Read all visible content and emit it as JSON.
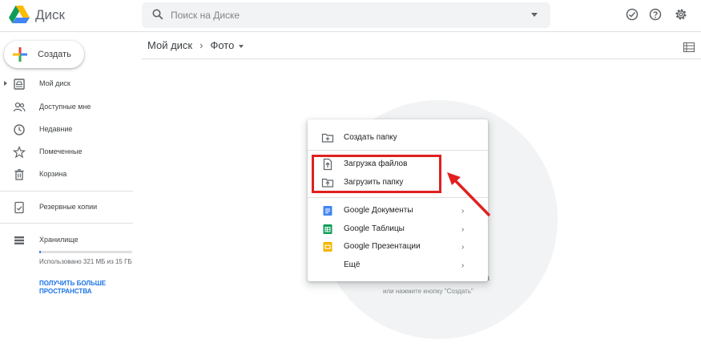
{
  "header": {
    "app_title": "Диск",
    "search_placeholder": "Поиск на Диске"
  },
  "sidebar": {
    "create_label": "Создать",
    "items": [
      {
        "label": "Мой диск",
        "icon": "my-drive-icon"
      },
      {
        "label": "Доступные мне",
        "icon": "shared-with-me-icon"
      },
      {
        "label": "Недавние",
        "icon": "recent-clock-icon"
      },
      {
        "label": "Помеченные",
        "icon": "star-icon"
      },
      {
        "label": "Корзина",
        "icon": "trash-icon"
      },
      {
        "label": "Резервные копии",
        "icon": "backups-icon"
      },
      {
        "label": "Хранилище",
        "icon": "storage-icon"
      }
    ],
    "storage_used_fraction": 0.02,
    "storage_text": "Использовано 321 МБ из 15 ГБ",
    "storage_link": "ПОЛУЧИТЬ БОЛЬШЕ ПРОСТРАНСТВА"
  },
  "breadcrumb": {
    "root": "Мой диск",
    "separator": "›",
    "current": "Фото"
  },
  "empty_state": {
    "text_fragment": "а",
    "hint": "или нажмите кнопку \"Создать\""
  },
  "menu": {
    "items": [
      {
        "label": "Создать папку",
        "icon": "new-folder-icon"
      },
      {
        "label": "Загрузка файлов",
        "icon": "file-upload-icon"
      },
      {
        "label": "Загрузить папку",
        "icon": "folder-upload-icon"
      },
      {
        "label": "Google Документы",
        "icon": "google-docs-icon",
        "submenu": true
      },
      {
        "label": "Google Таблицы",
        "icon": "google-sheets-icon",
        "submenu": true
      },
      {
        "label": "Google Презентации",
        "icon": "google-slides-icon",
        "submenu": true
      },
      {
        "label": "Ещё",
        "icon": "",
        "submenu": true
      }
    ],
    "chevron": "›"
  },
  "colors": {
    "accent_blue": "#1a73e8",
    "highlight_red": "#e02020",
    "docs_blue": "#4285f4",
    "sheets_green": "#0f9d58",
    "slides_yellow": "#f4b400"
  }
}
